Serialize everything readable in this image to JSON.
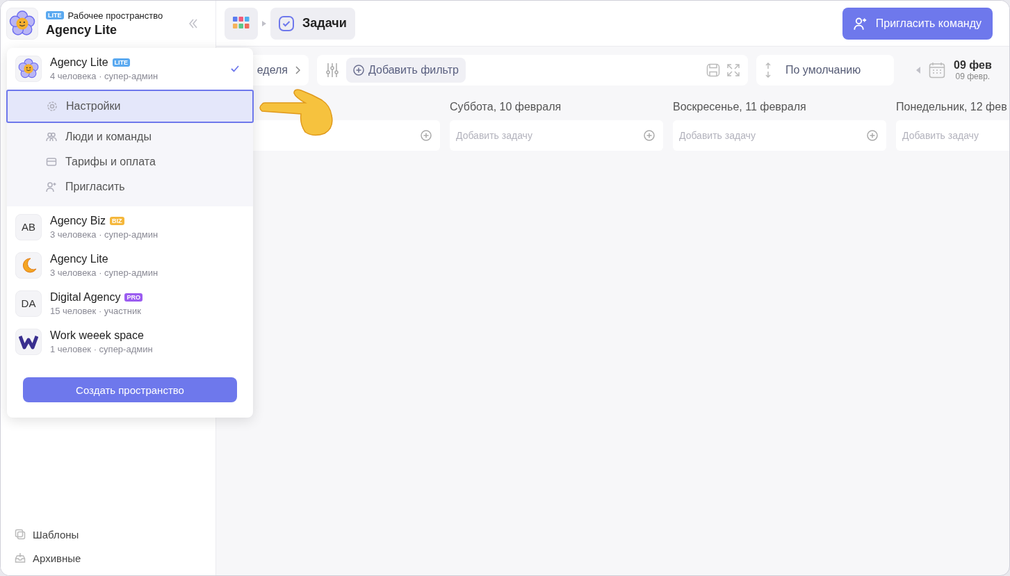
{
  "sidebar": {
    "header": {
      "badge": "LITE",
      "caption": "Рабочее пространство",
      "title": "Agency Lite"
    },
    "bottom_items": [
      {
        "kind": "templates",
        "label": "Шаблоны"
      },
      {
        "kind": "archive",
        "label": "Архивные"
      }
    ]
  },
  "topbar": {
    "breadcrumb": [
      {
        "kind": "apps"
      },
      {
        "kind": "tasks",
        "label": "Задачи"
      }
    ],
    "invite_button": "Пригласить команду"
  },
  "toolbar": {
    "period": "еделя",
    "add_filter": "Добавить фильтр",
    "sort": "По умолчанию",
    "date": "09 фев",
    "date_sub": "09 февр."
  },
  "columns": [
    {},
    {
      "heading": "Суббота, 10 февраля",
      "placeholder": "Добавить задачу"
    },
    {
      "heading": "Воскресенье, 11 февраля",
      "placeholder": "Добавить задачу"
    },
    {
      "heading": "Понедельник, 12 фев",
      "placeholder": "Добавить задачу",
      "cut_off": true
    }
  ],
  "workspace_menu": {
    "workspaces": [
      {
        "kind": "flower",
        "name": "Agency Lite",
        "badge": "LITE",
        "color": "#5aa9f0",
        "meta": "4 человека · супер-админ",
        "selected": true,
        "submenu": [
          {
            "kind": "gear",
            "label": "Настройки",
            "selected": true
          },
          {
            "kind": "people",
            "label": "Люди и команды",
            "selected": false
          },
          {
            "kind": "card",
            "label": "Тарифы и оплата",
            "selected": false
          },
          {
            "kind": "invite",
            "label": "Пригласить",
            "selected": false
          }
        ]
      },
      {
        "kind": "initials",
        "initials": "AB",
        "name": "Agency Biz",
        "badge": "BIZ",
        "color": "#f5b73b",
        "meta": "3 человека · супер-админ",
        "selected": false
      },
      {
        "kind": "moon",
        "name": "Agency Lite",
        "meta": "3 человека · супер-админ",
        "selected": false
      },
      {
        "kind": "initials",
        "initials": "DA",
        "name": "Digital Agency",
        "badge": "PRO",
        "color": "#9b5cf0",
        "meta": "15 человек · участник",
        "selected": false
      },
      {
        "kind": "w-logo",
        "name": "Work weeek space",
        "meta": "1 человек · супер-админ",
        "selected": false
      }
    ],
    "create_button": "Создать пространство"
  }
}
